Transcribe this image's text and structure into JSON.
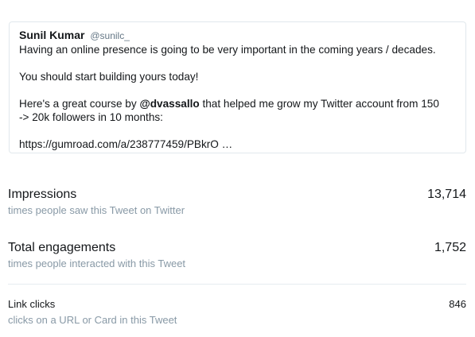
{
  "tweet": {
    "author_name": "Sunil Kumar",
    "author_handle": "@sunilc_",
    "line1": "Having an online presence is going to be very important in the coming years / decades.",
    "line2": "You should start building yours today!",
    "line3_prefix": "Here's a great course by ",
    "line3_mention": "@dvassallo",
    "line3_suffix": " that helped me grow my Twitter account from 150",
    "line4": "-> 20k followers in 10 months:",
    "link": "https://gumroad.com/a/238777459/PBkrO …"
  },
  "metrics": [
    {
      "title": "Impressions",
      "value": "13,714",
      "desc": "times people saw this Tweet on Twitter"
    },
    {
      "title": "Total engagements",
      "value": "1,752",
      "desc": "times people interacted with this Tweet"
    },
    {
      "title": "Link clicks",
      "value": "846",
      "desc": "clicks on a URL or Card in this Tweet"
    }
  ]
}
